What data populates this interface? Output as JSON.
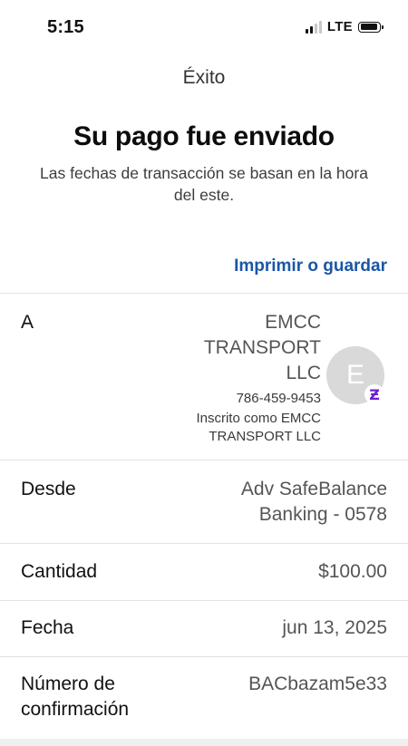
{
  "status_bar": {
    "time": "5:15",
    "network": "LTE"
  },
  "header": {
    "title": "Éxito"
  },
  "main": {
    "headline": "Su pago fue enviado",
    "subtext": "Las fechas de transacción se basan en la hora del este.",
    "print_link": "Imprimir o guardar"
  },
  "details": {
    "to": {
      "label": "A",
      "name_lines": [
        "EMCC",
        "TRANSPORT",
        "LLC"
      ],
      "phone": "786-459-9453",
      "enrolled_lines": [
        "Inscrito como EMCC",
        "TRANSPORT LLC"
      ],
      "avatar_initial": "E",
      "badge_icon": "zelle-icon",
      "badge_glyph": "Ƶ"
    },
    "from": {
      "label": "Desde",
      "value_lines": [
        "Adv SafeBalance",
        "Banking - 0578"
      ]
    },
    "amount": {
      "label": "Cantidad",
      "value": "$100.00"
    },
    "date": {
      "label": "Fecha",
      "value": "jun 13, 2025"
    },
    "confirmation": {
      "label_lines": [
        "Número de",
        "confirmación"
      ],
      "value": "BACbazam5e33"
    }
  },
  "colors": {
    "link": "#1a56a6",
    "badge": "#6d1ed4",
    "avatar_bg": "#d9d9d9"
  }
}
